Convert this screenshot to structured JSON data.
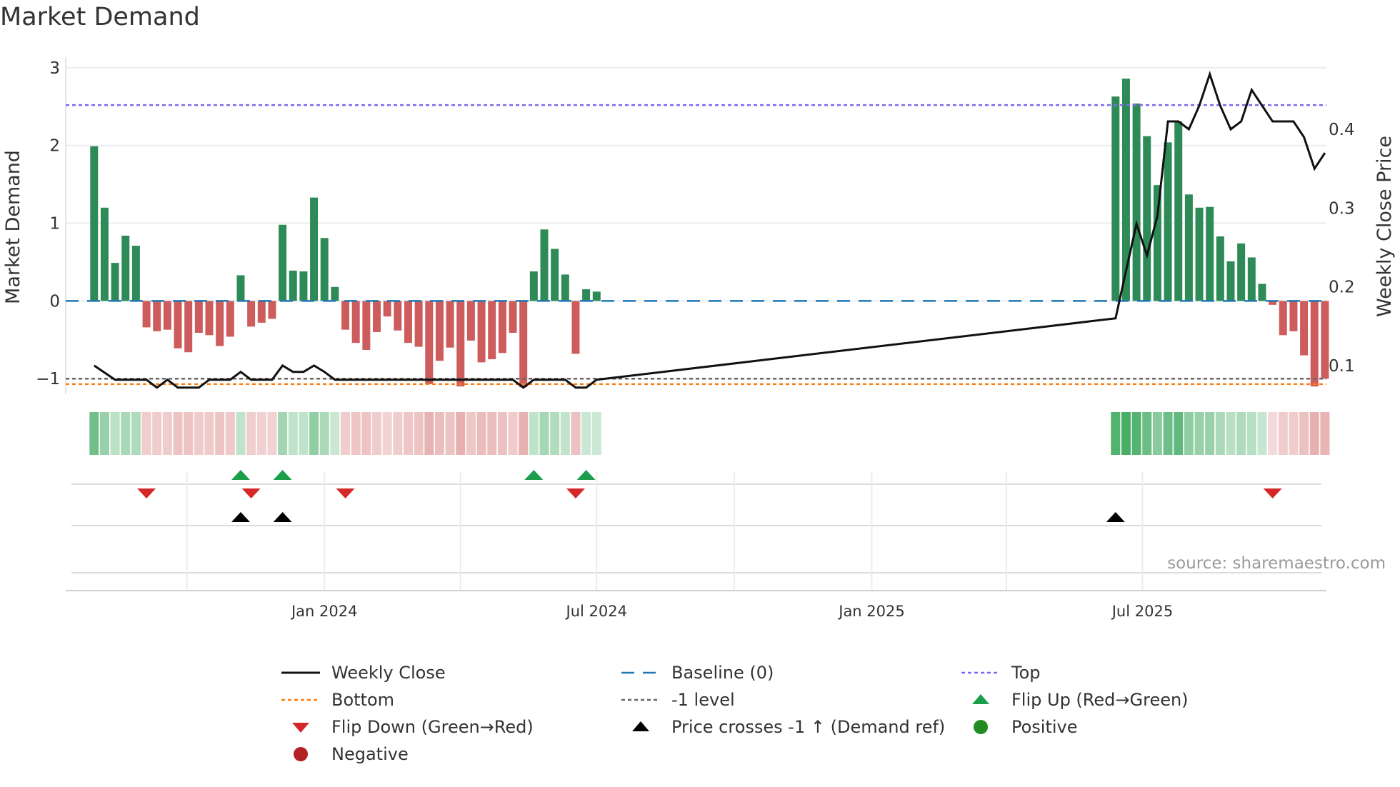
{
  "title": "Market Demand",
  "source": "source: sharemaestro.com",
  "colors": {
    "positive_bar": "#2e8b57",
    "negative_bar": "#cd5c5c",
    "price_line": "#111111",
    "baseline": "#1f77b4",
    "top": "#7b68ee",
    "bottom": "#ff7f0e",
    "minus_one": "#666666",
    "flip_up": "#1a9e4a",
    "flip_down": "#d62728",
    "cross": "#000000",
    "positive_dot": "#228b22",
    "negative_dot": "#b22222",
    "heat_pos": "49,163,84",
    "heat_neg": "205,92,92"
  },
  "chart_data": {
    "type": "bar",
    "title": "Market Demand",
    "ylabel": "Market Demand",
    "y2label": "Weekly Close Price",
    "ylim": [
      -1.2,
      3.1
    ],
    "y2lim": [
      0.0636,
      0.488
    ],
    "yticks": [
      {
        "v": 3,
        "label": "3"
      },
      {
        "v": 2,
        "label": "2"
      },
      {
        "v": 1,
        "label": "1"
      },
      {
        "v": 0,
        "label": "0"
      },
      {
        "v": -1,
        "label": "−1"
      }
    ],
    "y2ticks": [
      {
        "v": 0.4,
        "label": "0.4"
      },
      {
        "v": 0.3,
        "label": "0.3"
      },
      {
        "v": 0.2,
        "label": "0.2"
      },
      {
        "v": 0.1,
        "label": "0.1"
      }
    ],
    "xticks": [
      {
        "date": "2024-01-01",
        "label": "Jan 2024"
      },
      {
        "date": "2024-07-01",
        "label": "Jul 2024"
      },
      {
        "date": "2025-01-01",
        "label": "Jan 2025"
      },
      {
        "date": "2025-07-01",
        "label": "Jul 2025"
      }
    ],
    "minor_xgrid": [
      "2023-10-01",
      "2024-04-01",
      "2024-10-01",
      "2025-04-01"
    ],
    "xlim": [
      "2023-07-12",
      "2025-11-01"
    ],
    "levels": {
      "baseline": 0,
      "top": 2.52,
      "bottom": -1.07,
      "minus_one": -1
    },
    "segments": [
      {
        "start": "2023-07-31",
        "demand": [
          1.99,
          1.2,
          0.49,
          0.84,
          0.71,
          -0.34,
          -0.39,
          -0.37,
          -0.61,
          -0.66,
          -0.41,
          -0.44,
          -0.58,
          -0.46,
          0.33,
          -0.33,
          -0.28,
          -0.23,
          0.98,
          0.39,
          0.38,
          1.33,
          0.81,
          0.18,
          -0.37,
          -0.54,
          -0.63,
          -0.4,
          -0.2,
          -0.38,
          -0.54,
          -0.59,
          -1.07,
          -0.77,
          -0.6,
          -1.1,
          -0.51,
          -0.79,
          -0.75,
          -0.67,
          -0.41,
          -1.11,
          0.38,
          0.92,
          0.67,
          0.34,
          -0.68,
          0.15,
          0.12
        ],
        "price": [
          0.1,
          0.091,
          0.082,
          0.082,
          0.082,
          0.082,
          0.072,
          0.082,
          0.072,
          0.072,
          0.072,
          0.082,
          0.082,
          0.082,
          0.092,
          0.082,
          0.082,
          0.082,
          0.1,
          0.092,
          0.092,
          0.1,
          0.092,
          0.082,
          0.082,
          0.082,
          0.082,
          0.082,
          0.082,
          0.082,
          0.082,
          0.082,
          0.082,
          0.082,
          0.082,
          0.082,
          0.082,
          0.082,
          0.082,
          0.082,
          0.082,
          0.072,
          0.082,
          0.082,
          0.082,
          0.082,
          0.072,
          0.072,
          0.082
        ]
      },
      {
        "start": "2025-06-13",
        "demand": [
          2.63,
          2.86,
          2.54,
          2.12,
          1.49,
          2.04,
          2.31,
          1.37,
          1.2,
          1.21,
          0.83,
          0.51,
          0.74,
          0.56,
          0.22,
          -0.05,
          -0.44,
          -0.39,
          -0.7,
          -1.1,
          -1.0
        ],
        "price": [
          0.16,
          0.22,
          0.28,
          0.24,
          0.29,
          0.41,
          0.41,
          0.4,
          0.43,
          0.47,
          0.43,
          0.4,
          0.41,
          0.45,
          0.43,
          0.41,
          0.41,
          0.41,
          0.39,
          0.35,
          0.37
        ]
      }
    ],
    "flip_up": [
      {
        "seg": 0,
        "i": 14
      },
      {
        "seg": 0,
        "i": 18
      },
      {
        "seg": 0,
        "i": 42
      },
      {
        "seg": 0,
        "i": 47
      }
    ],
    "flip_down": [
      {
        "seg": 0,
        "i": 5
      },
      {
        "seg": 0,
        "i": 15
      },
      {
        "seg": 0,
        "i": 24
      },
      {
        "seg": 0,
        "i": 46
      },
      {
        "seg": 1,
        "i": 15
      }
    ],
    "price_cross": [
      {
        "seg": 0,
        "i": 14
      },
      {
        "seg": 0,
        "i": 18
      },
      {
        "seg": 1,
        "i": 0
      }
    ],
    "legend": [
      {
        "key": "line",
        "label": "Weekly Close"
      },
      {
        "key": "baseline",
        "label": "Baseline (0)"
      },
      {
        "key": "top",
        "label": "Top"
      },
      {
        "key": "bottom",
        "label": "Bottom"
      },
      {
        "key": "minus_one",
        "label": "-1 level"
      },
      {
        "key": "flip_up",
        "label": "Flip Up (Red→Green)"
      },
      {
        "key": "flip_down",
        "label": "Flip Down (Green→Red)"
      },
      {
        "key": "cross",
        "label": "Price crosses -1 ↑ (Demand ref)"
      },
      {
        "key": "positive",
        "label": "Positive"
      },
      {
        "key": "negative",
        "label": "Negative"
      }
    ],
    "legend_position": "bottom"
  }
}
